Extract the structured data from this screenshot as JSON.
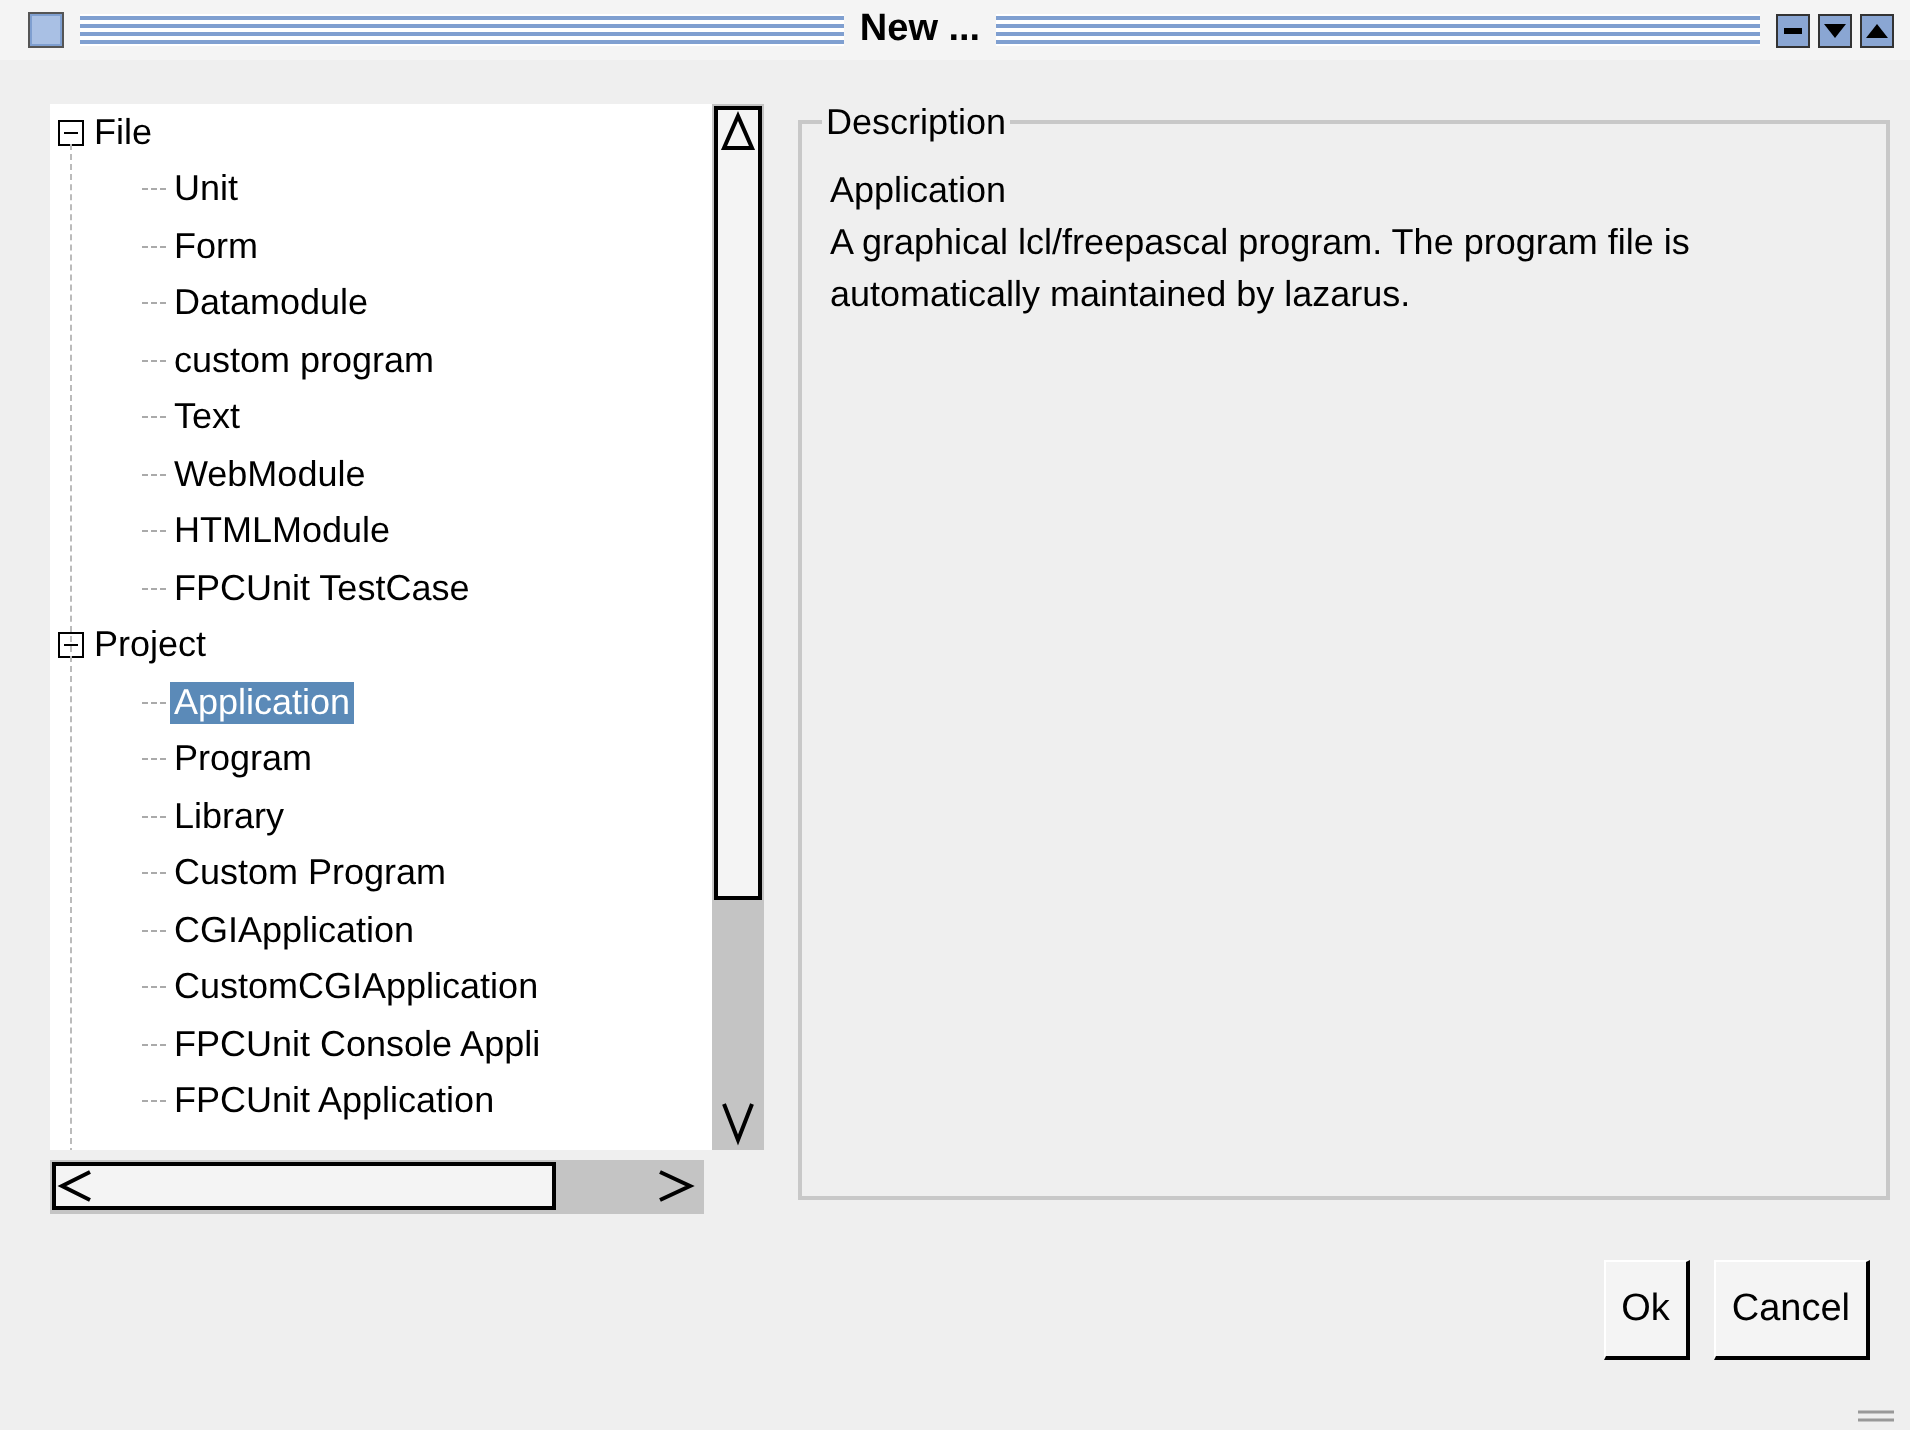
{
  "window": {
    "title": "New ..."
  },
  "tree": [
    {
      "label": "File",
      "expanded": true,
      "children": [
        {
          "label": "Unit",
          "selected": false
        },
        {
          "label": "Form",
          "selected": false
        },
        {
          "label": "Datamodule",
          "selected": false
        },
        {
          "label": "custom program",
          "selected": false
        },
        {
          "label": "Text",
          "selected": false
        },
        {
          "label": "WebModule",
          "selected": false
        },
        {
          "label": "HTMLModule",
          "selected": false
        },
        {
          "label": "FPCUnit TestCase",
          "selected": false
        }
      ]
    },
    {
      "label": "Project",
      "expanded": true,
      "children": [
        {
          "label": "Application",
          "selected": true
        },
        {
          "label": "Program",
          "selected": false
        },
        {
          "label": "Library",
          "selected": false
        },
        {
          "label": "Custom Program",
          "selected": false
        },
        {
          "label": "CGIApplication",
          "selected": false
        },
        {
          "label": "CustomCGIApplication",
          "selected": false
        },
        {
          "label": "FPCUnit Console Appli",
          "selected": false
        },
        {
          "label": "FPCUnit Application",
          "selected": false
        }
      ]
    }
  ],
  "description": {
    "title": "Description",
    "heading": "Application",
    "text": "A graphical lcl/freepascal program. The program file is automatically maintained by lazarus."
  },
  "buttons": [
    "Ok",
    "Cancel"
  ]
}
